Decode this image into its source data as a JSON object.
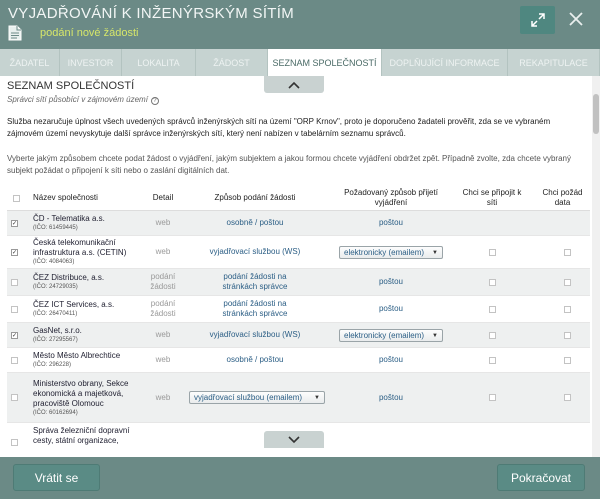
{
  "header": {
    "title": "VYJADŘOVÁNÍ K INŽENÝRSKÝM SÍTÍM",
    "subtitle": "podání nové žádosti"
  },
  "tabs": [
    {
      "label": "ŽADATEL",
      "active": false
    },
    {
      "label": "INVESTOR",
      "active": false
    },
    {
      "label": "LOKALITA",
      "active": false
    },
    {
      "label": "ŽÁDOST",
      "active": false
    },
    {
      "label": "SEZNAM SPOLEČNOSTÍ",
      "active": true
    },
    {
      "label": "DOPLŇUJÍCÍ INFORMACE",
      "active": false
    },
    {
      "label": "REKAPITULACE",
      "active": false
    }
  ],
  "section": {
    "title": "SEZNAM SPOLEČNOSTÍ",
    "subtitle": "Správci sítí působící v zájmovém území",
    "para1": "Služba nezaručuje úplnost všech uvedených správců inženýrských sítí na území \"ORP Krnov\", proto je doporučeno žadateli prověřit, zda se ve vybraném zájmovém území nevyskytuje další správce inženýrských sítí, který není nabízen v tabelárním seznamu správců.",
    "para2": "Vyberte jakým způsobem chcete podat žádost o vyjádření, jakým subjektem a jakou formou chcete vyjádření obdržet zpět. Případně zvolte, zda chcete vybraný subjekt požádat o připojení k síti nebo o zaslání digitálních dat."
  },
  "table": {
    "headers": {
      "name": "Název společnosti",
      "detail": "Detail",
      "method": "Způsob podání žádosti",
      "response": "Požadovaný způsob přijetí vyjádření",
      "connect": "Chci se připojit k síti",
      "data": "Chci požád data"
    },
    "rows": [
      {
        "checked": true,
        "name": "ČD - Telematika a.s.",
        "ico": "(IČO: 61459445)",
        "detail": "web",
        "method": "osobně / poštou",
        "response": "poštou",
        "response_select": false,
        "connect_cb": false,
        "data_cb": false
      },
      {
        "checked": true,
        "name": "Česká telekomunikační infrastruktura a.s. (CETIN)",
        "ico": "(IČO: 4084063)",
        "detail": "web",
        "method": "vyjadřovací službou (WS)",
        "response": "elektronicky (emailem)",
        "response_select": true,
        "connect_cb": true,
        "data_cb": true
      },
      {
        "checked": false,
        "name": "ČEZ Distribuce, a.s.",
        "ico": "(IČO: 24729035)",
        "detail": "podání žádosti",
        "method": "podání žádosti na stránkách správce",
        "response": "poštou",
        "response_select": false,
        "connect_cb": true,
        "data_cb": true
      },
      {
        "checked": false,
        "name": "ČEZ ICT Services, a.s.",
        "ico": "(IČO: 26470411)",
        "detail": "podání žádosti",
        "method": "podání žádosti na stránkách správce",
        "response": "poštou",
        "response_select": false,
        "connect_cb": true,
        "data_cb": true
      },
      {
        "checked": true,
        "name": "GasNet, s.r.o.",
        "ico": "(IČO: 27295567)",
        "detail": "web",
        "method": "vyjadřovací službou (WS)",
        "response": "elektronicky (emailem)",
        "response_select": true,
        "connect_cb": true,
        "data_cb": true
      },
      {
        "checked": false,
        "name": "Město Město Albrechtice",
        "ico": "(IČO: 296228)",
        "detail": "web",
        "method": "osobně / poštou",
        "response": "poštou",
        "response_select": false,
        "connect_cb": true,
        "data_cb": true
      },
      {
        "checked": false,
        "name": "Ministerstvo obrany, Sekce ekonomická a majetková, pracoviště Olomouc",
        "ico": "(IČO: 60162694)",
        "detail": "web",
        "method": "vyjadřovací službou (emailem)",
        "method_select": true,
        "response": "poštou",
        "response_select": false,
        "connect_cb": true,
        "data_cb": true
      },
      {
        "checked": false,
        "name": "Správa železniční dopravní cesty, státní organizace,",
        "ico": "",
        "detail": "",
        "method": "",
        "response": "",
        "response_select": false,
        "connect_cb": false,
        "data_cb": false
      }
    ]
  },
  "footer": {
    "back_label": "Vrátit se",
    "next_label": "Pokračovat"
  },
  "icons": {
    "expand": "expand-icon",
    "close": "close-icon",
    "document": "document-icon",
    "info": "info-icon"
  }
}
